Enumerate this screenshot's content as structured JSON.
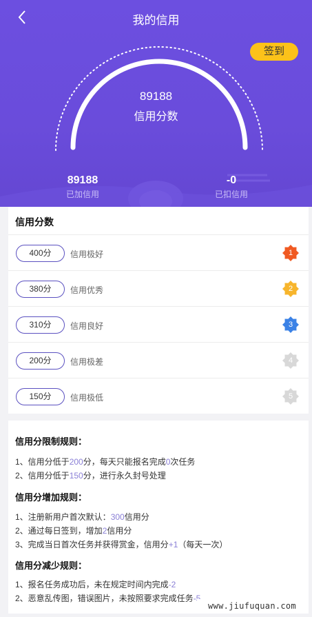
{
  "header": {
    "title": "我的信用",
    "sign_label": "签到",
    "score": "89188",
    "score_label": "信用分数",
    "added_value": "89188",
    "added_label": "已加信用",
    "deducted_value": "-0",
    "deducted_label": "已扣信用"
  },
  "levels": {
    "title": "信用分数",
    "items": [
      {
        "score": "400分",
        "label": "信用极好",
        "badge": "1",
        "color": "#f05a22"
      },
      {
        "score": "380分",
        "label": "信用优秀",
        "badge": "2",
        "color": "#f7b52c"
      },
      {
        "score": "310分",
        "label": "信用良好",
        "badge": "3",
        "color": "#3b82e6"
      },
      {
        "score": "200分",
        "label": "信用极差",
        "badge": "4",
        "color": "#d8d8d8"
      },
      {
        "score": "150分",
        "label": "信用极低",
        "badge": "5",
        "color": "#d8d8d8"
      }
    ]
  },
  "rules": {
    "limit_title": "信用分限制规则：",
    "limit_1": [
      "1、信用分低于",
      "200",
      "分，每天只能报名完成",
      "0",
      "次任务"
    ],
    "limit_2": [
      "2、信用分低于",
      "150",
      "分，进行永久封号处理"
    ],
    "add_title": "信用分增加规则：",
    "add_1": [
      "1、注册新用户首次默认：",
      "300",
      "信用分"
    ],
    "add_2": [
      "2、通过每日签到，增加",
      "2",
      "信用分"
    ],
    "add_3": [
      "3、完成当日首次任务并获得赏金，信用分",
      "+1",
      "（每天一次）"
    ],
    "reduce_title": "信用分减少规则：",
    "reduce_1": [
      "1、报名任务成功后，未在规定时间内完成",
      "-2"
    ],
    "reduce_2": [
      "2、恶意乱传图，错误图片，未按照要求完成任务",
      "-5"
    ]
  },
  "watermark": "www.jiufuquan.com",
  "colors": {
    "brand": "#6a4cdb",
    "accent": "#fcc21a",
    "highlight": "#8a7fd6"
  }
}
